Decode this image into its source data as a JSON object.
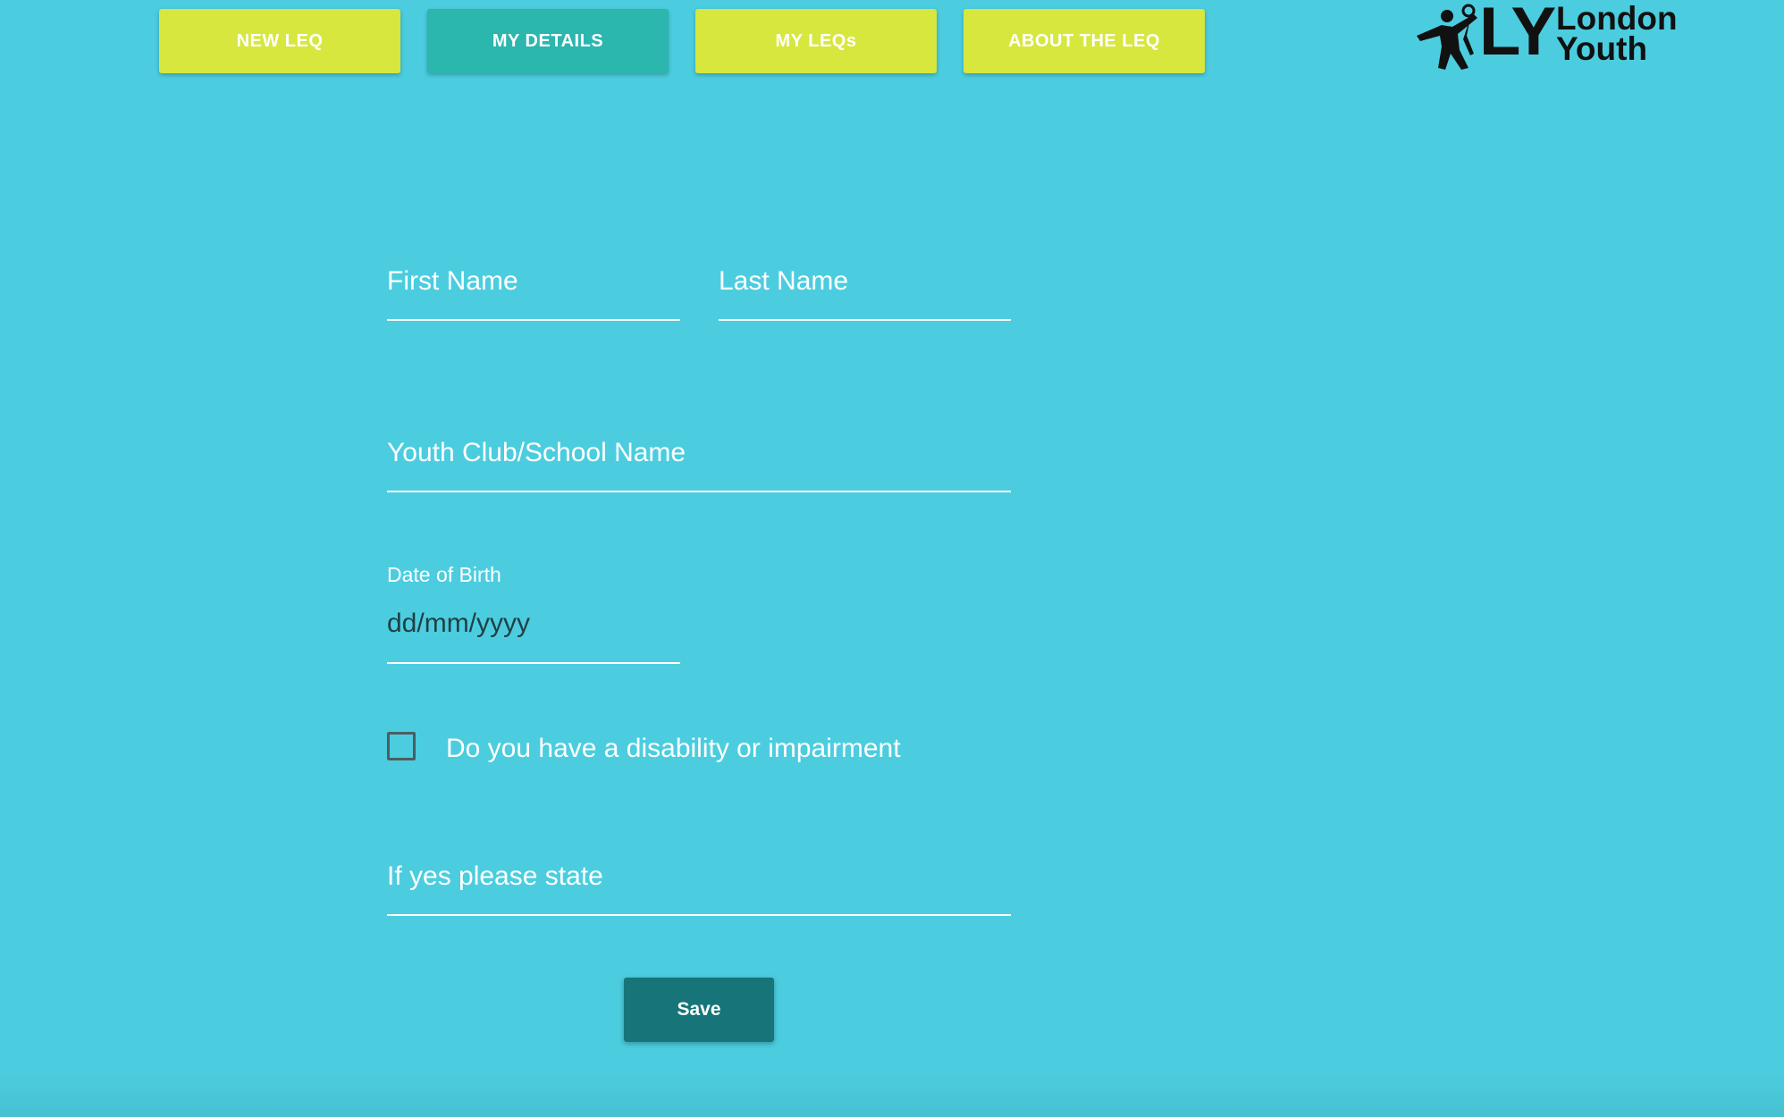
{
  "nav": {
    "new_leq": "NEW LEQ",
    "my_details": "MY DETAILS",
    "my_leqs": "MY LEQs",
    "about": "ABOUT THE LEQ",
    "active": "MY DETAILS"
  },
  "logo": {
    "mark": "LY",
    "line1": "London",
    "line2": "Youth"
  },
  "form": {
    "first_name_placeholder": "First Name",
    "last_name_placeholder": "Last Name",
    "club_placeholder": "Youth Club/School Name",
    "dob_label": "Date of Birth",
    "dob_placeholder": "dd/mm/yyyy",
    "disability_label": "Do you have a disability or impairment",
    "disability_checked": false,
    "state_placeholder": "If yes please state",
    "save_label": "Save"
  },
  "colors": {
    "background": "#4bcddf",
    "nav_button": "#d7e73d",
    "nav_active": "#2bb6ae",
    "save_button": "#177579"
  },
  "icons": {
    "logo_figure": "people-figure-icon",
    "checkbox": "checkbox-unchecked-icon"
  }
}
